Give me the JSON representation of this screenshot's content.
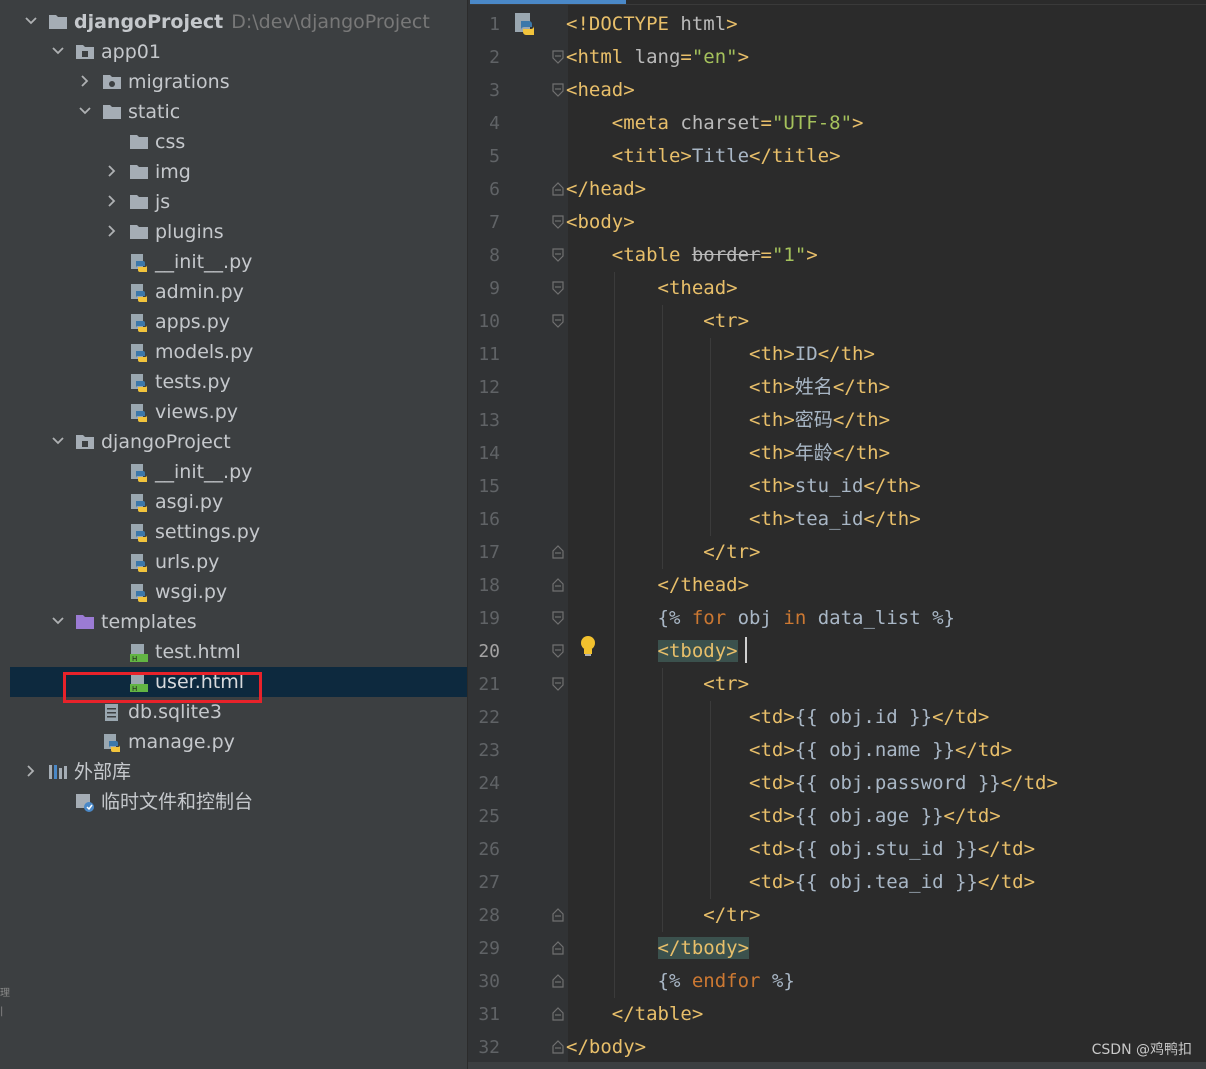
{
  "tree": [
    {
      "label": "djangoProject",
      "path": "D:\\dev\\djangoProject",
      "bold": true,
      "arrow": "down",
      "icon": "folder-icon",
      "depth": 0
    },
    {
      "label": "app01",
      "arrow": "down",
      "icon": "module-folder-icon",
      "depth": 1
    },
    {
      "label": "migrations",
      "arrow": "right",
      "icon": "package-folder-icon",
      "depth": 2
    },
    {
      "label": "static",
      "arrow": "down",
      "icon": "folder-icon",
      "depth": 2
    },
    {
      "label": "css",
      "arrow": "",
      "icon": "folder-icon",
      "depth": 3
    },
    {
      "label": "img",
      "arrow": "right",
      "icon": "folder-icon",
      "depth": 3
    },
    {
      "label": "js",
      "arrow": "right",
      "icon": "folder-icon",
      "depth": 3
    },
    {
      "label": "plugins",
      "arrow": "right",
      "icon": "folder-icon",
      "depth": 3
    },
    {
      "label": "__init__.py",
      "arrow": "",
      "icon": "python-file-icon",
      "depth": 3
    },
    {
      "label": "admin.py",
      "arrow": "",
      "icon": "python-file-icon",
      "depth": 3
    },
    {
      "label": "apps.py",
      "arrow": "",
      "icon": "python-file-icon",
      "depth": 3
    },
    {
      "label": "models.py",
      "arrow": "",
      "icon": "python-file-icon",
      "depth": 3
    },
    {
      "label": "tests.py",
      "arrow": "",
      "icon": "python-file-icon",
      "depth": 3
    },
    {
      "label": "views.py",
      "arrow": "",
      "icon": "python-file-icon",
      "depth": 3
    },
    {
      "label": "djangoProject",
      "arrow": "down",
      "icon": "module-folder-icon",
      "depth": 1
    },
    {
      "label": "__init__.py",
      "arrow": "",
      "icon": "python-file-icon",
      "depth": 3
    },
    {
      "label": "asgi.py",
      "arrow": "",
      "icon": "python-file-icon",
      "depth": 3
    },
    {
      "label": "settings.py",
      "arrow": "",
      "icon": "python-file-icon",
      "depth": 3
    },
    {
      "label": "urls.py",
      "arrow": "",
      "icon": "python-file-icon",
      "depth": 3
    },
    {
      "label": "wsgi.py",
      "arrow": "",
      "icon": "python-file-icon",
      "depth": 3
    },
    {
      "label": "templates",
      "arrow": "down",
      "icon": "templates-folder-icon",
      "depth": 1
    },
    {
      "label": "test.html",
      "arrow": "",
      "icon": "html-file-icon",
      "depth": 3
    },
    {
      "label": "user.html",
      "arrow": "",
      "icon": "html-file-icon",
      "depth": 3,
      "selected": true
    },
    {
      "label": "db.sqlite3",
      "arrow": "",
      "icon": "text-file-icon",
      "depth": 2
    },
    {
      "label": "manage.py",
      "arrow": "",
      "icon": "python-file-icon",
      "depth": 2
    },
    {
      "label": "外部库",
      "arrow": "right",
      "icon": "library-icon",
      "depth": 0
    },
    {
      "label": "临时文件和控制台",
      "arrow": "",
      "icon": "scratch-icon",
      "depth": 1
    }
  ],
  "editor": {
    "current_line": 20,
    "lines": [
      {
        "n": "1",
        "tokens": [
          [
            "tag",
            "<!DOCTYPE "
          ],
          [
            "attr",
            "html"
          ],
          [
            "tag",
            ">"
          ]
        ]
      },
      {
        "n": "2",
        "tokens": [
          [
            "tag",
            "<html "
          ],
          [
            "attr",
            "lang"
          ],
          [
            "tag",
            "="
          ],
          [
            "str",
            "\"en\""
          ],
          [
            "tag",
            ">"
          ]
        ]
      },
      {
        "n": "3",
        "tokens": [
          [
            "tag",
            "<head>"
          ]
        ]
      },
      {
        "n": "4",
        "tokens": [
          [
            "text",
            "    "
          ],
          [
            "tag",
            "<meta "
          ],
          [
            "attr",
            "charset"
          ],
          [
            "tag",
            "="
          ],
          [
            "str",
            "\"UTF-8\""
          ],
          [
            "tag",
            ">"
          ]
        ]
      },
      {
        "n": "5",
        "tokens": [
          [
            "text",
            "    "
          ],
          [
            "tag",
            "<title>"
          ],
          [
            "text",
            "Title"
          ],
          [
            "tag",
            "</title>"
          ]
        ]
      },
      {
        "n": "6",
        "tokens": [
          [
            "tag",
            "</head>"
          ]
        ]
      },
      {
        "n": "7",
        "tokens": [
          [
            "tag",
            "<body>"
          ]
        ]
      },
      {
        "n": "8",
        "tokens": [
          [
            "text",
            "    "
          ],
          [
            "tag",
            "<table "
          ],
          [
            "strike",
            "border"
          ],
          [
            "tag",
            "="
          ],
          [
            "str",
            "\"1\""
          ],
          [
            "tag",
            ">"
          ]
        ]
      },
      {
        "n": "9",
        "tokens": [
          [
            "text",
            "        "
          ],
          [
            "tag",
            "<thead>"
          ]
        ]
      },
      {
        "n": "10",
        "tokens": [
          [
            "text",
            "            "
          ],
          [
            "tag",
            "<tr>"
          ]
        ]
      },
      {
        "n": "11",
        "tokens": [
          [
            "text",
            "                "
          ],
          [
            "tag",
            "<th>"
          ],
          [
            "text",
            "ID"
          ],
          [
            "tag",
            "</th>"
          ]
        ]
      },
      {
        "n": "12",
        "tokens": [
          [
            "text",
            "                "
          ],
          [
            "tag",
            "<th>"
          ],
          [
            "text",
            "姓名"
          ],
          [
            "tag",
            "</th>"
          ]
        ]
      },
      {
        "n": "13",
        "tokens": [
          [
            "text",
            "                "
          ],
          [
            "tag",
            "<th>"
          ],
          [
            "text",
            "密码"
          ],
          [
            "tag",
            "</th>"
          ]
        ]
      },
      {
        "n": "14",
        "tokens": [
          [
            "text",
            "                "
          ],
          [
            "tag",
            "<th>"
          ],
          [
            "text",
            "年龄"
          ],
          [
            "tag",
            "</th>"
          ]
        ]
      },
      {
        "n": "15",
        "tokens": [
          [
            "text",
            "                "
          ],
          [
            "tag",
            "<th>"
          ],
          [
            "text",
            "stu_id"
          ],
          [
            "tag",
            "</th>"
          ]
        ]
      },
      {
        "n": "16",
        "tokens": [
          [
            "text",
            "                "
          ],
          [
            "tag",
            "<th>"
          ],
          [
            "text",
            "tea_id"
          ],
          [
            "tag",
            "</th>"
          ]
        ]
      },
      {
        "n": "17",
        "tokens": [
          [
            "text",
            "            "
          ],
          [
            "tag",
            "</tr>"
          ]
        ]
      },
      {
        "n": "18",
        "tokens": [
          [
            "text",
            "        "
          ],
          [
            "tag",
            "</thead>"
          ]
        ]
      },
      {
        "n": "19",
        "tokens": [
          [
            "text",
            "        "
          ],
          [
            "tpl",
            "{% "
          ],
          [
            "kw",
            "for"
          ],
          [
            "tpl",
            " obj "
          ],
          [
            "kw",
            "in"
          ],
          [
            "tpl",
            " data_list %}"
          ]
        ]
      },
      {
        "n": "20",
        "tokens": [
          [
            "text",
            "        "
          ],
          [
            "taghl",
            "<tbody>"
          ]
        ]
      },
      {
        "n": "21",
        "tokens": [
          [
            "text",
            "            "
          ],
          [
            "tag",
            "<tr>"
          ]
        ]
      },
      {
        "n": "22",
        "tokens": [
          [
            "text",
            "                "
          ],
          [
            "tag",
            "<td>"
          ],
          [
            "tpl",
            "{{ obj.id }}"
          ],
          [
            "tag",
            "</td>"
          ]
        ]
      },
      {
        "n": "23",
        "tokens": [
          [
            "text",
            "                "
          ],
          [
            "tag",
            "<td>"
          ],
          [
            "tpl",
            "{{ obj.name }}"
          ],
          [
            "tag",
            "</td>"
          ]
        ]
      },
      {
        "n": "24",
        "tokens": [
          [
            "text",
            "                "
          ],
          [
            "tag",
            "<td>"
          ],
          [
            "tpl",
            "{{ obj.password }}"
          ],
          [
            "tag",
            "</td>"
          ]
        ]
      },
      {
        "n": "25",
        "tokens": [
          [
            "text",
            "                "
          ],
          [
            "tag",
            "<td>"
          ],
          [
            "tpl",
            "{{ obj.age }}"
          ],
          [
            "tag",
            "</td>"
          ]
        ]
      },
      {
        "n": "26",
        "tokens": [
          [
            "text",
            "                "
          ],
          [
            "tag",
            "<td>"
          ],
          [
            "tpl",
            "{{ obj.stu_id }}"
          ],
          [
            "tag",
            "</td>"
          ]
        ]
      },
      {
        "n": "27",
        "tokens": [
          [
            "text",
            "                "
          ],
          [
            "tag",
            "<td>"
          ],
          [
            "tpl",
            "{{ obj.tea_id }}"
          ],
          [
            "tag",
            "</td>"
          ]
        ]
      },
      {
        "n": "28",
        "tokens": [
          [
            "text",
            "            "
          ],
          [
            "tag",
            "</tr>"
          ]
        ]
      },
      {
        "n": "29",
        "tokens": [
          [
            "text",
            "        "
          ],
          [
            "taghl",
            "</tbody>"
          ]
        ]
      },
      {
        "n": "30",
        "tokens": [
          [
            "text",
            "        "
          ],
          [
            "tpl",
            "{% "
          ],
          [
            "kw",
            "endfor"
          ],
          [
            "tpl",
            " %}"
          ]
        ]
      },
      {
        "n": "31",
        "tokens": [
          [
            "text",
            "    "
          ],
          [
            "tag",
            "</table>"
          ]
        ]
      },
      {
        "n": "32",
        "tokens": [
          [
            "tag",
            "</body>"
          ]
        ]
      }
    ],
    "fold_markers": {
      "2": "open",
      "3": "open",
      "6": "close",
      "7": "open",
      "8": "open",
      "9": "open",
      "10": "open",
      "17": "close",
      "18": "close",
      "19": "open",
      "20": "open",
      "21": "open",
      "28": "close",
      "29": "close",
      "30": "close",
      "31": "close",
      "32": "close"
    }
  },
  "watermark": "CSDN @鸡鸭扣",
  "strip_text": "理\n|",
  "colors": {
    "selection": "#0d293e",
    "highlight_border": "#e8222a",
    "accent": "#4a88c7"
  }
}
